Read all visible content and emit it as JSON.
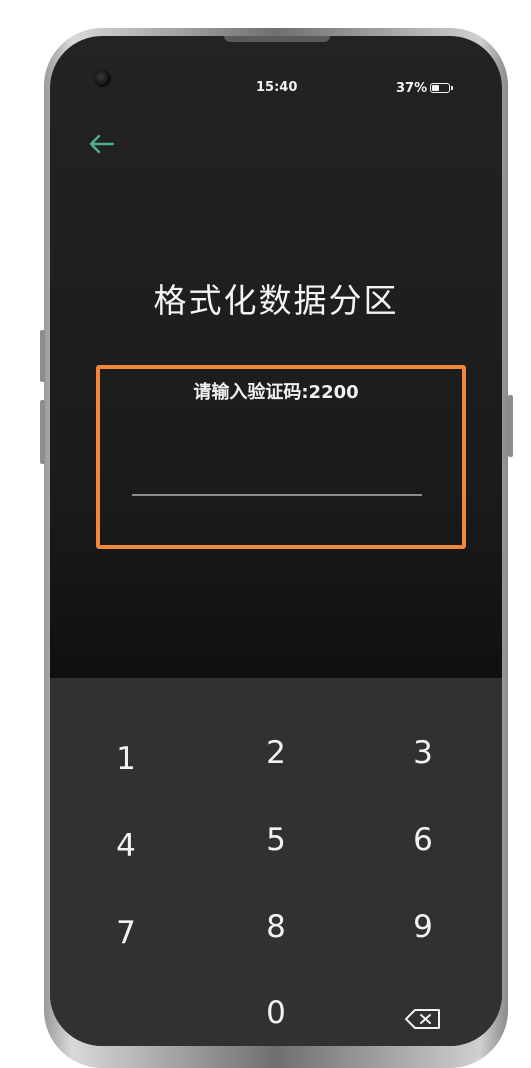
{
  "status_bar": {
    "time": "15:40",
    "battery": "37%"
  },
  "page": {
    "title": "格式化数据分区"
  },
  "verification": {
    "prompt": "请输入验证码:2200",
    "value": "",
    "placeholder": ""
  },
  "keypad": {
    "keys": [
      "1",
      "2",
      "3",
      "4",
      "5",
      "6",
      "7",
      "8",
      "9",
      "0"
    ],
    "delete_icon": "backspace-icon"
  },
  "colors": {
    "background": "#1b1b1b",
    "keypad_background": "#313131",
    "back_arrow": "#4fae8f",
    "highlight_border": "#f2883a"
  }
}
